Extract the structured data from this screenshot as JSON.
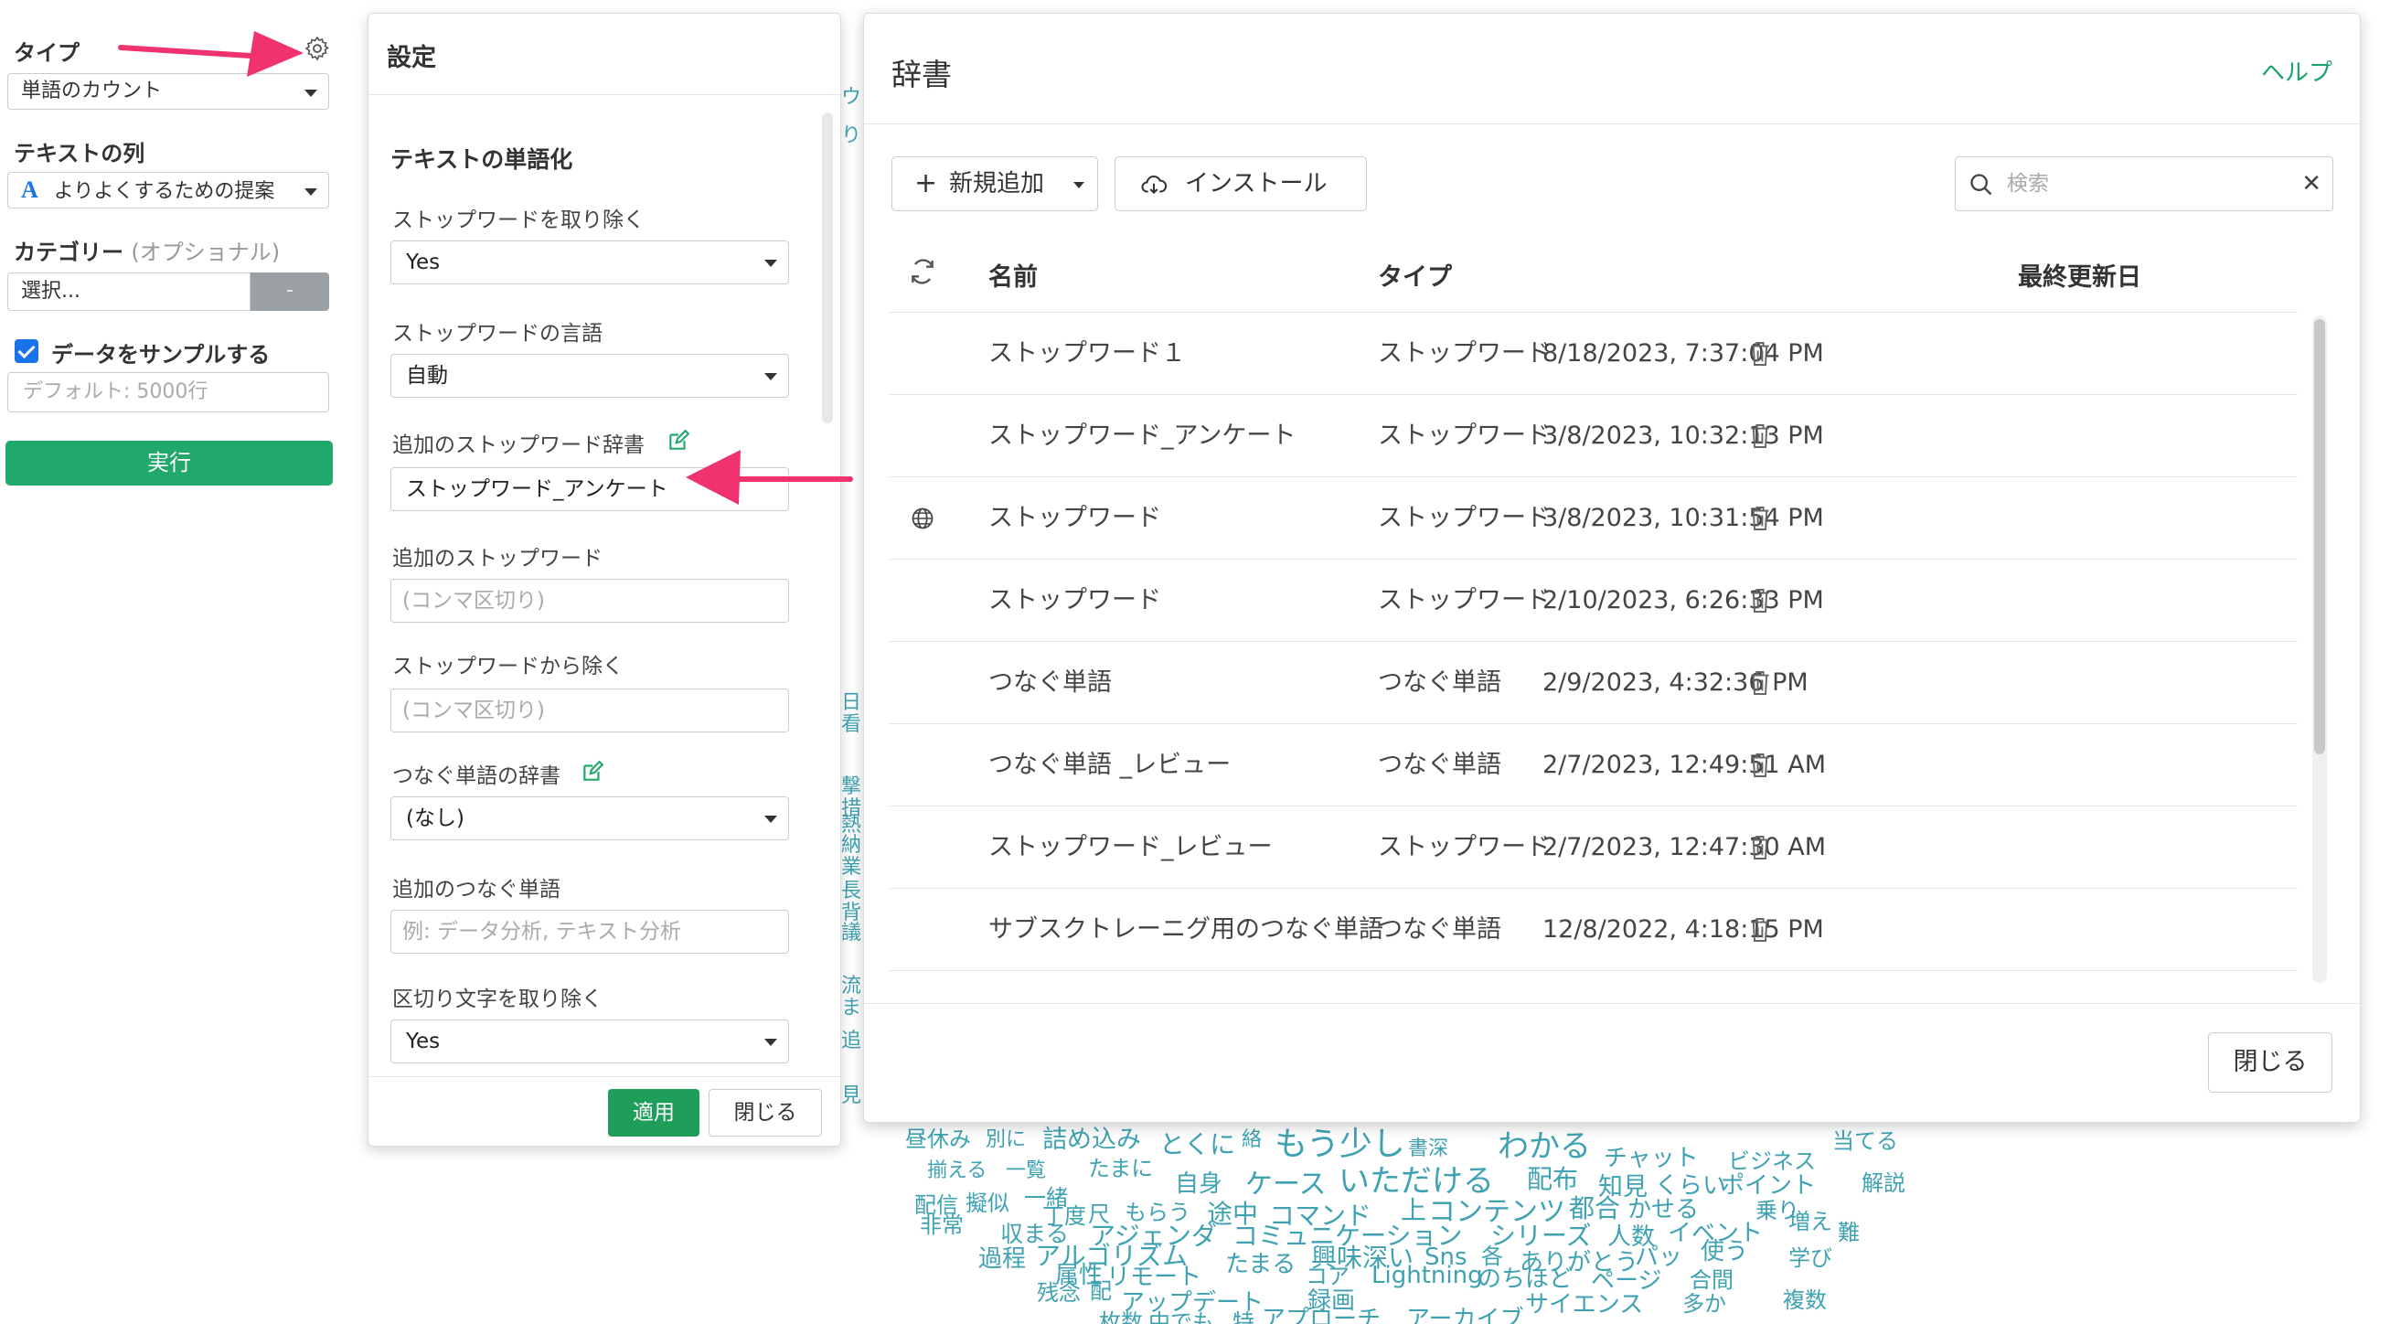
{
  "sidebar": {
    "type_label": "タイプ",
    "type_value": "単語のカウント",
    "text_col_label": "テキストの列",
    "text_col_value": "よりよくするための提案",
    "category_label": "カテゴリー",
    "category_optional": "(オプショナル)",
    "category_value": "選択...",
    "category_button": "-",
    "sample_label": "データをサンプルする",
    "sample_placeholder": "デフォルト: 5000行",
    "run_button": "実行"
  },
  "settings": {
    "title": "設定",
    "section_title": "テキストの単語化",
    "fields": {
      "remove_stopwords_label": "ストップワードを取り除く",
      "remove_stopwords_value": "Yes",
      "stopword_lang_label": "ストップワードの言語",
      "stopword_lang_value": "自動",
      "extra_dict_label": "追加のストップワード辞書",
      "extra_dict_value": "ストップワード_アンケート",
      "extra_words_label": "追加のストップワード",
      "extra_words_placeholder": "(コンマ区切り)",
      "exclude_label": "ストップワードから除く",
      "exclude_placeholder": "(コンマ区切り)",
      "connect_dict_label": "つなぐ単語の辞書",
      "connect_dict_value": "(なし)",
      "extra_connect_label": "追加のつなぐ単語",
      "extra_connect_placeholder": "例: データ分析, テキスト分析",
      "remove_delim_label": "区切り文字を取り除く",
      "remove_delim_value": "Yes"
    },
    "apply_button": "適用",
    "close_button": "閉じる"
  },
  "dictionary": {
    "title": "辞書",
    "help_link": "ヘルプ",
    "new_button": "新規追加",
    "install_button": "インストール",
    "search_placeholder": "検索",
    "columns": {
      "name": "名前",
      "type": "タイプ",
      "updated": "最終更新日"
    },
    "rows": [
      {
        "name": "ストップワード１",
        "type": "ストップワード",
        "updated": "8/18/2023, 7:37:04 PM",
        "global": false
      },
      {
        "name": "ストップワード_アンケート",
        "type": "ストップワード",
        "updated": "3/8/2023, 10:32:13 PM",
        "global": false
      },
      {
        "name": "ストップワード",
        "type": "ストップワード",
        "updated": "3/8/2023, 10:31:54 PM",
        "global": true
      },
      {
        "name": "ストップワード",
        "type": "ストップワード",
        "updated": "2/10/2023, 6:26:33 PM",
        "global": false
      },
      {
        "name": "つなぐ単語",
        "type": "つなぐ単語",
        "updated": "2/9/2023, 4:32:36 PM",
        "global": false
      },
      {
        "name": "つなぐ単語 _レビュー",
        "type": "つなぐ単語",
        "updated": "2/7/2023, 12:49:51 AM",
        "global": false
      },
      {
        "name": "ストップワード_レビュー",
        "type": "ストップワード",
        "updated": "2/7/2023, 12:47:30 AM",
        "global": false
      },
      {
        "name": "サブスクトレーニグ用のつなぐ単語",
        "type": "つなぐ単語",
        "updated": "12/8/2022, 4:18:15 PM",
        "global": false
      }
    ],
    "close_button": "閉じる"
  },
  "word_cloud": {
    "words": [
      "昼休み",
      "別に",
      "詰め込み",
      "とくに",
      "絡",
      "もう少し",
      "書深",
      "わかる",
      "チャット",
      "ビジネス",
      "当てる",
      "揃える",
      "一覧",
      "たまに",
      "自身",
      "ケース",
      "いただける",
      "配布",
      "知見",
      "くらい",
      "ポイント",
      "解説",
      "配信",
      "擬似",
      "一緒",
      "丁度",
      "尺",
      "もらう",
      "途中",
      "コマンド",
      "上",
      "コンテンツ",
      "都合",
      "かせる",
      "乗り",
      "増え",
      "難",
      "非常",
      "収まる",
      "アジェンダ",
      "コミュニケーション",
      "シリーズ",
      "人数",
      "イベント",
      "過程",
      "アルゴリズム",
      "たまる",
      "興味深い",
      "Sns",
      "各",
      "ありがとう",
      "パッ",
      "使う",
      "学び",
      "残念",
      "配",
      "属性",
      "リモート",
      "コア",
      "Lightning",
      "のちほど",
      "ページ",
      "合間",
      "アップデート",
      "録画",
      "サイエンス",
      "多か",
      "複数",
      "枚数",
      "中でも",
      "特",
      "アプローチ",
      "アーカイブ"
    ],
    "strip": [
      "ウ",
      "り",
      "日",
      "看",
      "撃",
      "措",
      "熱",
      "納",
      "業",
      "長",
      "背",
      "議",
      "流",
      "ま",
      "追",
      "見"
    ]
  },
  "colors": {
    "accent_green": "#20a96b",
    "link_green": "#1aa36a",
    "arrow_pink": "#f0336e",
    "checkbox_blue": "#1a73e8",
    "cloud_teal": "#3fa2b2"
  }
}
